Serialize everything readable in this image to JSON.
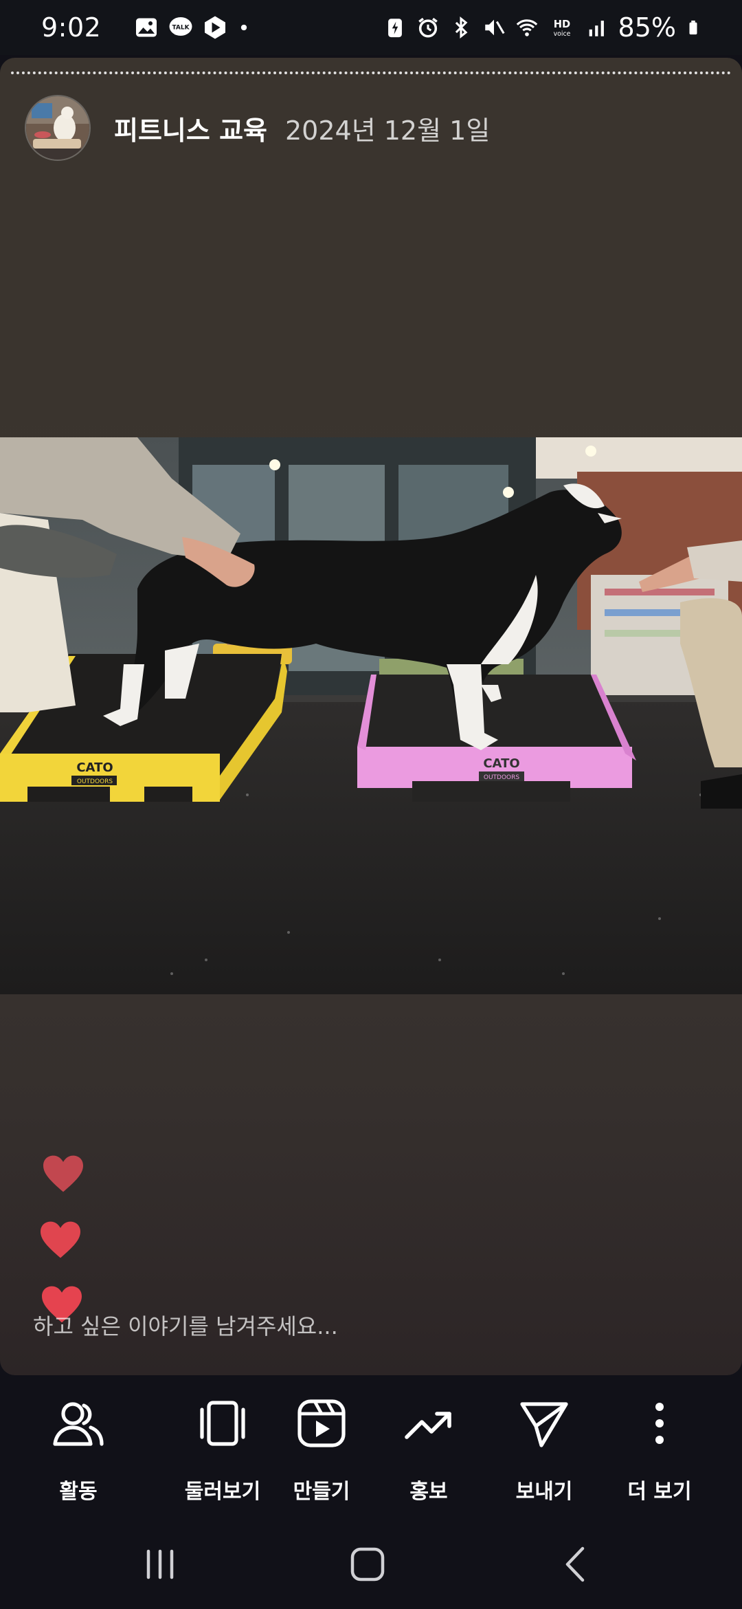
{
  "status_bar": {
    "time": "9:02",
    "battery": "85%",
    "left_icons": [
      "gallery-icon",
      "kakaotalk-icon",
      "app-icon",
      "dot-icon"
    ],
    "right_icons": [
      "battery-saver-icon",
      "alarm-icon",
      "bluetooth-icon",
      "mute-icon",
      "wifi-icon",
      "hd-voice-icon",
      "signal-icon",
      "battery-icon"
    ]
  },
  "story": {
    "author": "피트니스 교육",
    "date": "2024년 12월 1일",
    "comment_placeholder": "하고 싶은 이야기를 남겨주세요...",
    "photo_box_brand": "CATO",
    "photo_box_subbrand": "OUTDOORS",
    "background_color": "#3a342e",
    "heart_color": "#e0454f"
  },
  "actions": [
    {
      "label": "활동",
      "icon": "people-icon"
    },
    {
      "label": "둘러보기",
      "icon": "browse-icon"
    },
    {
      "label": "만들기",
      "icon": "create-icon"
    },
    {
      "label": "홍보",
      "icon": "trending-icon"
    },
    {
      "label": "보내기",
      "icon": "send-icon"
    },
    {
      "label": "더 보기",
      "icon": "more-icon"
    }
  ],
  "nav": [
    "recents-icon",
    "home-icon",
    "back-icon"
  ]
}
